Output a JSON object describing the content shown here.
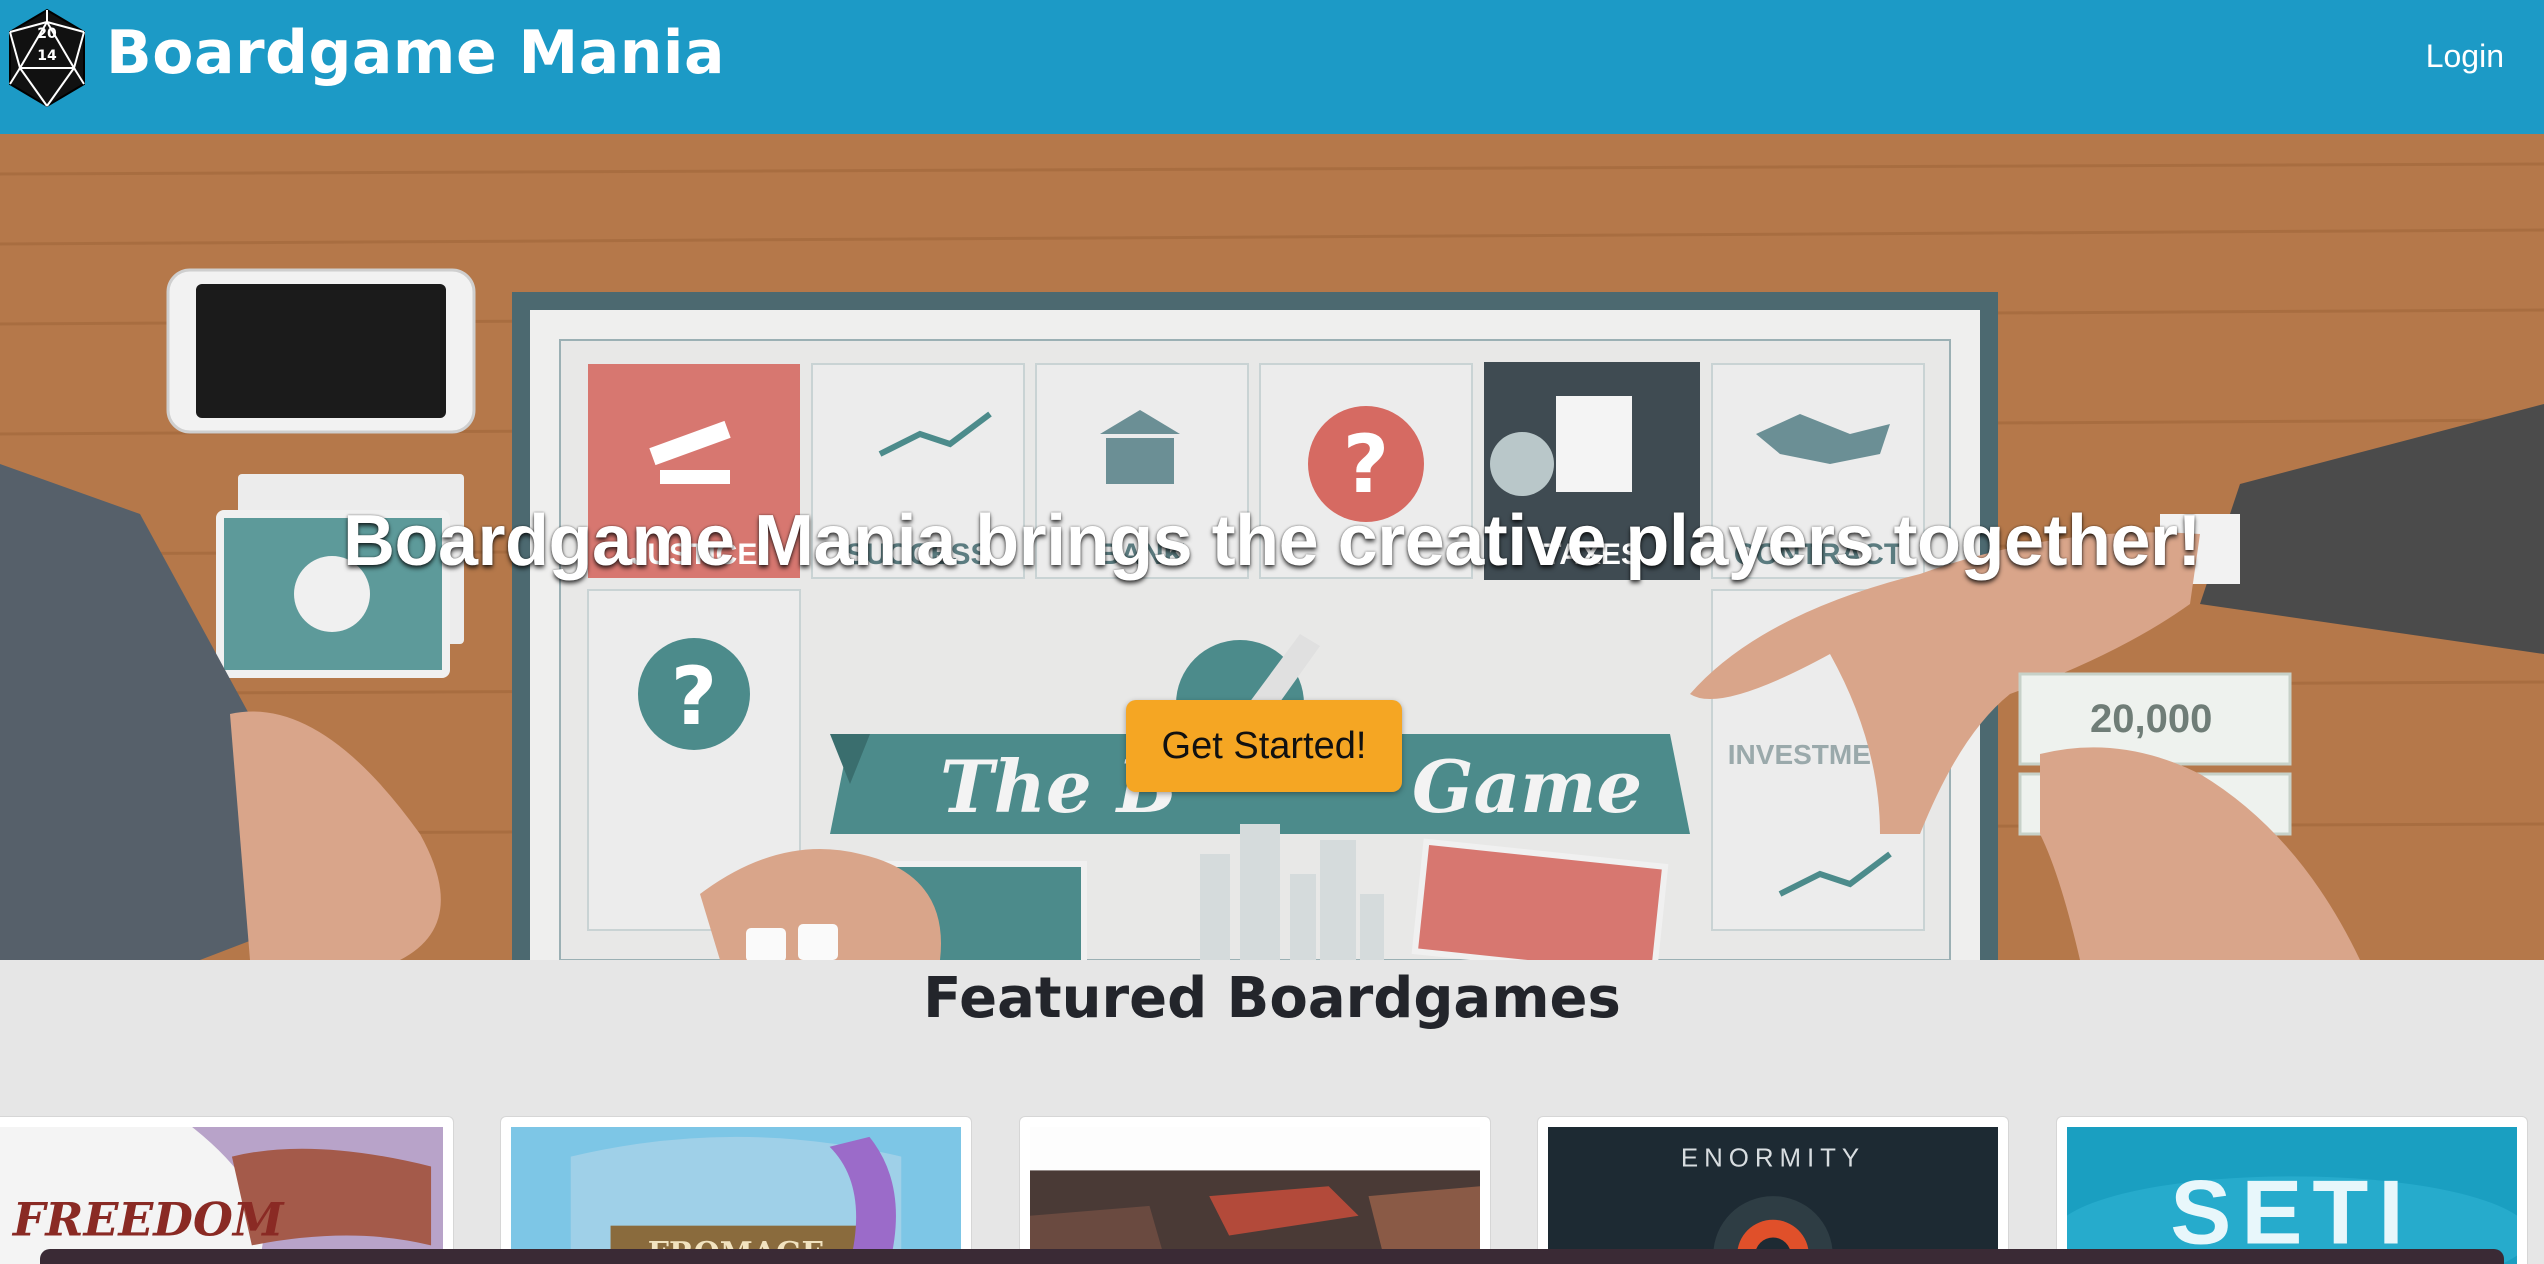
{
  "header": {
    "brand": "Boardgame Mania",
    "login_label": "Login",
    "logo_die": {
      "top": "20",
      "center": "14"
    }
  },
  "hero": {
    "headline": "Boardgame Mania brings the creative players together!",
    "cta_label": "Get Started!",
    "board": {
      "tiles": [
        "JUSTICE",
        "SUCCESS",
        "BANK",
        "TAXES",
        "CONTRACT",
        "INVESTMENT"
      ],
      "banner": "The B",
      "banner_end": "Game",
      "money": "20,000"
    }
  },
  "featured": {
    "title": "Featured Boardgames",
    "cards": [
      {
        "name": "freedom-card",
        "thumb_text": "FREEDOM"
      },
      {
        "name": "fromage-card",
        "thumb_text": "FROMAGE"
      },
      {
        "name": "battle-card",
        "thumb_text": ""
      },
      {
        "name": "enormity-card",
        "thumb_text": "ENORMITY"
      },
      {
        "name": "seti-card",
        "thumb_text": "SETI"
      }
    ]
  },
  "colors": {
    "header": "#1c9ac6",
    "cta": "#f5a623",
    "section_bg": "#e6e6e6"
  }
}
